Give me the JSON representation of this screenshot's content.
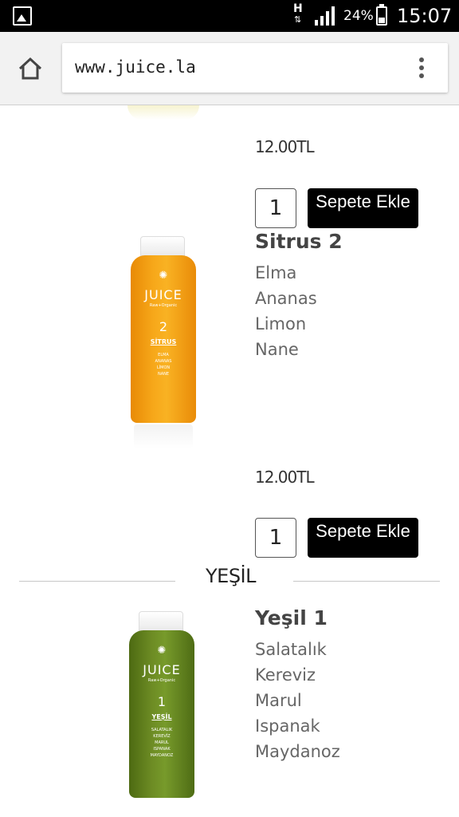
{
  "status_bar": {
    "network": "H",
    "network_arrows": "⇅",
    "battery": "24%",
    "time": "15:07"
  },
  "browser": {
    "url": "www.juice.la"
  },
  "products": {
    "first": {
      "price": "12.00TL",
      "quantity": "1",
      "add_label": "Sepete Ekle"
    },
    "sitrus2": {
      "name": "Sitrus 2",
      "ingredients": [
        "Elma",
        "Ananas",
        "Limon",
        "Nane"
      ],
      "price": "12.00TL",
      "quantity": "1",
      "add_label": "Sepete Ekle",
      "bottle": {
        "logo": "✺",
        "brand": "JUICE",
        "sub": "Raw+Organic",
        "number": "2",
        "name": "SİTRUS",
        "ingredients": [
          "ELMA",
          "ANANAS",
          "LİMON",
          "NANE"
        ]
      }
    },
    "yesil1": {
      "name": "Yeşil 1",
      "ingredients": [
        "Salatalık",
        "Kereviz",
        "Marul",
        "Ispanak",
        "Maydanoz"
      ],
      "bottle": {
        "logo": "✺",
        "brand": "JUICE",
        "sub": "Raw+Organic",
        "number": "1",
        "name": "YEŞİL",
        "ingredients": [
          "SALATALIK",
          "KEREVİZ",
          "MARUL",
          "ISPANAK",
          "MAYDANOZ"
        ]
      }
    }
  },
  "section": {
    "title": "YEŞİL"
  },
  "colors": {
    "button_bg": "#000000",
    "orange_bottle": "#f7a81a",
    "green_bottle": "#6d8c24"
  }
}
